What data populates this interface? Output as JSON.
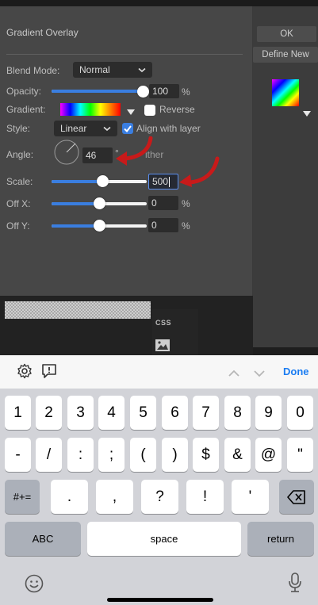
{
  "panel": {
    "title": "Gradient Overlay",
    "blend_mode": {
      "label": "Blend Mode:",
      "value": "Normal"
    },
    "opacity": {
      "label": "Opacity:",
      "value": "100",
      "unit": "%",
      "level": 1.0
    },
    "gradient": {
      "label": "Gradient:",
      "reverse_label": "Reverse",
      "reverse_checked": false
    },
    "style": {
      "label": "Style:",
      "value": "Linear",
      "align_label": "Align with layer",
      "align_checked": true
    },
    "angle": {
      "label": "Angle:",
      "value": "46",
      "unit": "°",
      "dither_partial": "ither",
      "dither_checked": false
    },
    "scale": {
      "label": "Scale:",
      "value": "500",
      "level": 0.5
    },
    "offx": {
      "label": "Off X:",
      "value": "0",
      "unit": "%",
      "level": 0.5
    },
    "offy": {
      "label": "Off Y:",
      "value": "0",
      "unit": "%",
      "level": 0.5
    }
  },
  "right": {
    "ok": "OK",
    "define_new": "Define New"
  },
  "tools": {
    "css": "CSS"
  },
  "accessory": {
    "done": "Done"
  },
  "keyboard": {
    "row1": [
      "1",
      "2",
      "3",
      "4",
      "5",
      "6",
      "7",
      "8",
      "9",
      "0"
    ],
    "row2": [
      "-",
      "/",
      ":",
      ";",
      "(",
      ")",
      "$",
      "&",
      "@",
      "\""
    ],
    "row3_left": "#+=",
    "row3": [
      ".",
      ",",
      "?",
      "!",
      "'"
    ],
    "abc": "ABC",
    "space": "space",
    "return": "return"
  },
  "colors": {
    "accent": "#3a7ee0",
    "arrow": "#e02020",
    "panel": "#474747"
  }
}
